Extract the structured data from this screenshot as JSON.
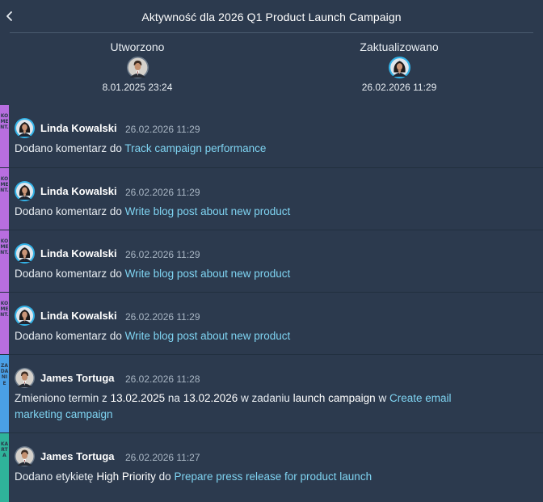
{
  "header": {
    "title": "Aktywność dla 2026 Q1 Product Launch Campaign"
  },
  "meta": {
    "created": {
      "label": "Utworzono",
      "date": "8.01.2025 23:24"
    },
    "updated": {
      "label": "Zaktualizowano",
      "date": "26.02.2026 11:29"
    }
  },
  "colors": {
    "comment_tag": "#b86ee0",
    "task_tag": "#4aa0e6",
    "card_tag": "#2fb39a",
    "link": "#7fd4f2"
  },
  "activities": [
    {
      "tag": "KOMENT.",
      "user": "Linda Kowalski",
      "time": "26.02.2026 11:29",
      "prefix": "Dodano komentarz do",
      "link": "Track campaign performance"
    },
    {
      "tag": "KOMENT.",
      "user": "Linda Kowalski",
      "time": "26.02.2026 11:29",
      "prefix": "Dodano komentarz do",
      "link": "Write blog post about new product"
    },
    {
      "tag": "KOMENT.",
      "user": "Linda Kowalski",
      "time": "26.02.2026 11:29",
      "prefix": "Dodano komentarz do",
      "link": "Write blog post about new product"
    },
    {
      "tag": "KOMENT.",
      "user": "Linda Kowalski",
      "time": "26.02.2026 11:29",
      "prefix": "Dodano komentarz do",
      "link": "Write blog post about new product"
    },
    {
      "tag": "ZADANIE",
      "user": "James Tortuga",
      "time": "26.02.2026 11:28",
      "p1": "Zmieniono termin z",
      "from": "13.02.2025",
      "p2": "na",
      "to": "13.02.2026",
      "p3": "w zadaniu",
      "task": "launch campaign",
      "p4": "w",
      "link": "Create email marketing campaign"
    },
    {
      "tag": "KARTA",
      "user": "James Tortuga",
      "time": "26.02.2026 11:27",
      "prefix": "Dodano etykietę",
      "label": "High Priority",
      "p2": "do",
      "link": "Prepare press release for product launch"
    }
  ]
}
